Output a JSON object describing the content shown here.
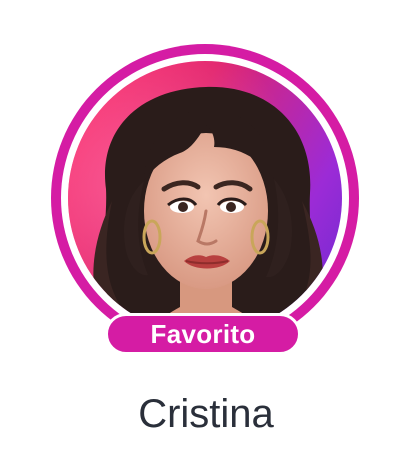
{
  "profile": {
    "badge_label": "Favorito",
    "name": "Cristina",
    "avatar_icon": "profile-avatar-photo",
    "colors": {
      "accent": "#d51ca4",
      "name_text": "#2a2f3a",
      "badge_text": "#ffffff",
      "background": "#ffffff"
    }
  }
}
